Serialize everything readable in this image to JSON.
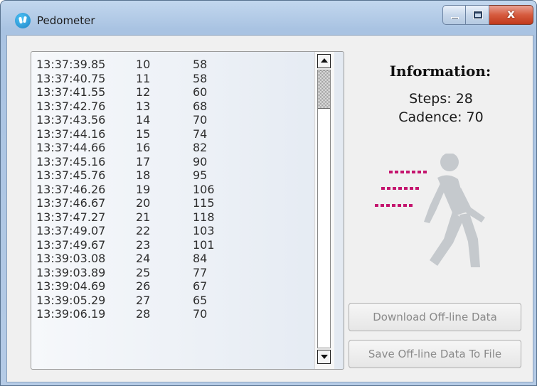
{
  "window": {
    "title": "Pedometer",
    "controls": {
      "minimize_label": "",
      "maximize_label": "",
      "close_label": "x"
    }
  },
  "log": {
    "rows": [
      {
        "time": "13:37:39.85",
        "step": "10",
        "value": "58"
      },
      {
        "time": "13:37:40.75",
        "step": "11",
        "value": "58"
      },
      {
        "time": "13:37:41.55",
        "step": "12",
        "value": "60"
      },
      {
        "time": "13:37:42.76",
        "step": "13",
        "value": "68"
      },
      {
        "time": "13:37:43.56",
        "step": "14",
        "value": "70"
      },
      {
        "time": "13:37:44.16",
        "step": "15",
        "value": "74"
      },
      {
        "time": "13:37:44.66",
        "step": "16",
        "value": "82"
      },
      {
        "time": "13:37:45.16",
        "step": "17",
        "value": "90"
      },
      {
        "time": "13:37:45.76",
        "step": "18",
        "value": "95"
      },
      {
        "time": "13:37:46.26",
        "step": "19",
        "value": "106"
      },
      {
        "time": "13:37:46.67",
        "step": "20",
        "value": "115"
      },
      {
        "time": "13:37:47.27",
        "step": "21",
        "value": "118"
      },
      {
        "time": "13:37:49.07",
        "step": "22",
        "value": "103"
      },
      {
        "time": "13:37:49.67",
        "step": "23",
        "value": "101"
      },
      {
        "time": "13:39:03.08",
        "step": "24",
        "value": "84"
      },
      {
        "time": "13:39:03.89",
        "step": "25",
        "value": "77"
      },
      {
        "time": "13:39:04.69",
        "step": "26",
        "value": "67"
      },
      {
        "time": "13:39:05.29",
        "step": "27",
        "value": "65"
      },
      {
        "time": "13:39:06.19",
        "step": "28",
        "value": "70"
      }
    ]
  },
  "info": {
    "title": "Information:",
    "steps_text": "Steps: 28",
    "cadence_text": "Cadence: 70",
    "illustration_icon": "walking-person-icon",
    "motion_color": "#c4146e",
    "figure_color": "#c5c9cd"
  },
  "buttons": {
    "download": "Download Off-line Data",
    "save": "Save Off-line Data To File"
  }
}
